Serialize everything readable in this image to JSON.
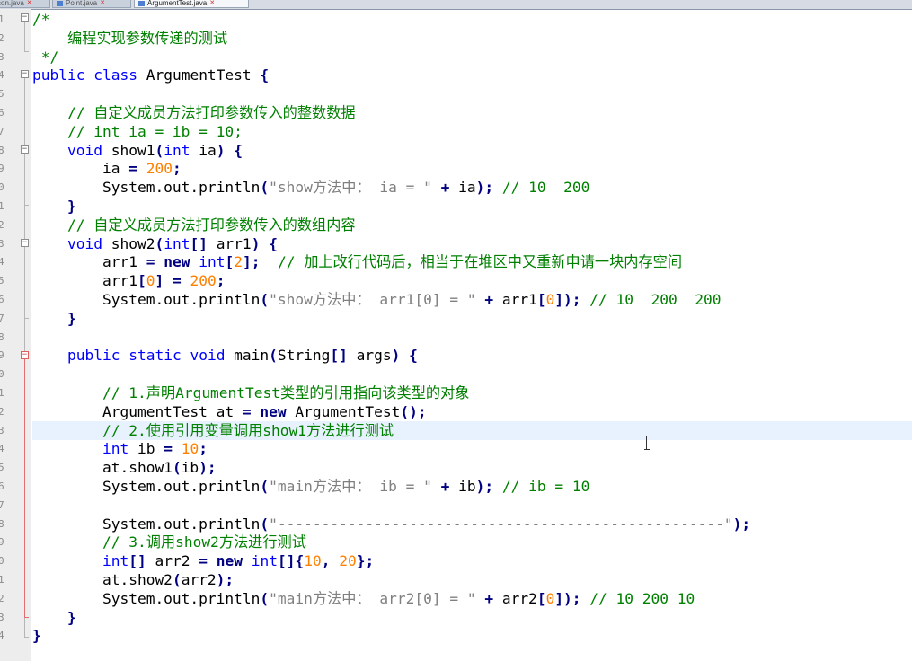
{
  "tabs": [
    {
      "label": "son.java"
    },
    {
      "label": "Point.java"
    },
    {
      "label": "ArgumentTest.java"
    }
  ],
  "line_numbers": [
    "1",
    "2",
    "3",
    "4",
    "5",
    "6",
    "7",
    "8",
    "9",
    "0",
    "1",
    "2",
    "3",
    "4",
    "5",
    "6",
    "7",
    "8",
    "9",
    "0",
    "1",
    "2",
    "3",
    "4",
    "5",
    "6",
    "7",
    "8",
    "9",
    "0",
    "1",
    "2",
    "3",
    "4"
  ],
  "lines": [
    [
      {
        "t": "/*",
        "c": "cm"
      }
    ],
    [
      {
        "t": "    ",
        "c": ""
      },
      {
        "t": "编程实现参数传递的测试",
        "c": "cm cn"
      }
    ],
    [
      {
        "t": " */",
        "c": "cm"
      }
    ],
    [
      {
        "t": "public",
        "c": "kw"
      },
      {
        "t": " ",
        "c": ""
      },
      {
        "t": "class",
        "c": "kw"
      },
      {
        "t": " ArgumentTest ",
        "c": ""
      },
      {
        "t": "{",
        "c": "op"
      }
    ],
    [],
    [
      {
        "t": "    // ",
        "c": "cm"
      },
      {
        "t": "自定义成员方法打印参数传入的整数数据",
        "c": "cm cn"
      }
    ],
    [
      {
        "t": "    // int ia = ib = 10;",
        "c": "cm"
      }
    ],
    [
      {
        "t": "    ",
        "c": ""
      },
      {
        "t": "void",
        "c": "kw"
      },
      {
        "t": " show1",
        "c": ""
      },
      {
        "t": "(",
        "c": "op"
      },
      {
        "t": "int",
        "c": "kw"
      },
      {
        "t": " ia",
        "c": ""
      },
      {
        "t": ")",
        "c": "op"
      },
      {
        "t": " ",
        "c": ""
      },
      {
        "t": "{",
        "c": "op"
      }
    ],
    [
      {
        "t": "        ia ",
        "c": ""
      },
      {
        "t": "=",
        "c": "op"
      },
      {
        "t": " ",
        "c": ""
      },
      {
        "t": "200",
        "c": "num"
      },
      {
        "t": ";",
        "c": "op"
      }
    ],
    [
      {
        "t": "        System.out.println",
        "c": ""
      },
      {
        "t": "(",
        "c": "op"
      },
      {
        "t": "\"show",
        "c": "str"
      },
      {
        "t": "方法中：",
        "c": "str cn"
      },
      {
        "t": " ia = \"",
        "c": "str"
      },
      {
        "t": " ",
        "c": ""
      },
      {
        "t": "+",
        "c": "op"
      },
      {
        "t": " ia",
        "c": ""
      },
      {
        "t": ");",
        "c": "op"
      },
      {
        "t": " // 10  200",
        "c": "cm"
      }
    ],
    [
      {
        "t": "    ",
        "c": ""
      },
      {
        "t": "}",
        "c": "op"
      }
    ],
    [
      {
        "t": "    // ",
        "c": "cm"
      },
      {
        "t": "自定义成员方法打印参数传入的数组内容",
        "c": "cm cn"
      }
    ],
    [
      {
        "t": "    ",
        "c": ""
      },
      {
        "t": "void",
        "c": "kw"
      },
      {
        "t": " show2",
        "c": ""
      },
      {
        "t": "(",
        "c": "op"
      },
      {
        "t": "int",
        "c": "kw"
      },
      {
        "t": "[]",
        "c": "op"
      },
      {
        "t": " arr1",
        "c": ""
      },
      {
        "t": ")",
        "c": "op"
      },
      {
        "t": " ",
        "c": ""
      },
      {
        "t": "{",
        "c": "op"
      }
    ],
    [
      {
        "t": "        arr1 ",
        "c": ""
      },
      {
        "t": "=",
        "c": "op"
      },
      {
        "t": " ",
        "c": ""
      },
      {
        "t": "new",
        "c": "kw op"
      },
      {
        "t": " ",
        "c": ""
      },
      {
        "t": "int",
        "c": "kw"
      },
      {
        "t": "[",
        "c": "op"
      },
      {
        "t": "2",
        "c": "num"
      },
      {
        "t": "];",
        "c": "op"
      },
      {
        "t": "  // ",
        "c": "cm"
      },
      {
        "t": "加上改行代码后，相当于在堆区中又重新申请一块内存空间",
        "c": "cm cn"
      }
    ],
    [
      {
        "t": "        arr1",
        "c": ""
      },
      {
        "t": "[",
        "c": "op"
      },
      {
        "t": "0",
        "c": "num"
      },
      {
        "t": "]",
        "c": "op"
      },
      {
        "t": " ",
        "c": ""
      },
      {
        "t": "=",
        "c": "op"
      },
      {
        "t": " ",
        "c": ""
      },
      {
        "t": "200",
        "c": "num"
      },
      {
        "t": ";",
        "c": "op"
      }
    ],
    [
      {
        "t": "        System.out.println",
        "c": ""
      },
      {
        "t": "(",
        "c": "op"
      },
      {
        "t": "\"show",
        "c": "str"
      },
      {
        "t": "方法中：",
        "c": "str cn"
      },
      {
        "t": " arr1[0] = \"",
        "c": "str"
      },
      {
        "t": " ",
        "c": ""
      },
      {
        "t": "+",
        "c": "op"
      },
      {
        "t": " arr1",
        "c": ""
      },
      {
        "t": "[",
        "c": "op"
      },
      {
        "t": "0",
        "c": "num"
      },
      {
        "t": "]);",
        "c": "op"
      },
      {
        "t": " // 10  200  200",
        "c": "cm"
      }
    ],
    [
      {
        "t": "    ",
        "c": ""
      },
      {
        "t": "}",
        "c": "op"
      }
    ],
    [],
    [
      {
        "t": "    ",
        "c": ""
      },
      {
        "t": "public",
        "c": "kw"
      },
      {
        "t": " ",
        "c": ""
      },
      {
        "t": "static",
        "c": "kw"
      },
      {
        "t": " ",
        "c": ""
      },
      {
        "t": "void",
        "c": "kw"
      },
      {
        "t": " main",
        "c": ""
      },
      {
        "t": "(",
        "c": "op"
      },
      {
        "t": "String",
        "c": ""
      },
      {
        "t": "[]",
        "c": "op"
      },
      {
        "t": " args",
        "c": ""
      },
      {
        "t": ")",
        "c": "op"
      },
      {
        "t": " ",
        "c": ""
      },
      {
        "t": "{",
        "c": "op"
      }
    ],
    [],
    [
      {
        "t": "        // 1.",
        "c": "cm"
      },
      {
        "t": "声明",
        "c": "cm cn"
      },
      {
        "t": "ArgumentTest",
        "c": "cm"
      },
      {
        "t": "类型的引用指向该类型的对象",
        "c": "cm cn"
      }
    ],
    [
      {
        "t": "        ArgumentTest at ",
        "c": ""
      },
      {
        "t": "=",
        "c": "op"
      },
      {
        "t": " ",
        "c": ""
      },
      {
        "t": "new",
        "c": "kw op"
      },
      {
        "t": " ArgumentTest",
        "c": ""
      },
      {
        "t": "();",
        "c": "op"
      }
    ],
    [
      {
        "t": "        // 2.",
        "c": "cm"
      },
      {
        "t": "使用引用变量调用",
        "c": "cm cn"
      },
      {
        "t": "show1",
        "c": "cm"
      },
      {
        "t": "方法进行测试",
        "c": "cm cn"
      }
    ],
    [
      {
        "t": "        ",
        "c": ""
      },
      {
        "t": "int",
        "c": "kw"
      },
      {
        "t": " ib ",
        "c": ""
      },
      {
        "t": "=",
        "c": "op"
      },
      {
        "t": " ",
        "c": ""
      },
      {
        "t": "10",
        "c": "num"
      },
      {
        "t": ";",
        "c": "op"
      }
    ],
    [
      {
        "t": "        at.show1",
        "c": ""
      },
      {
        "t": "(",
        "c": "op"
      },
      {
        "t": "ib",
        "c": ""
      },
      {
        "t": ");",
        "c": "op"
      }
    ],
    [
      {
        "t": "        System.out.println",
        "c": ""
      },
      {
        "t": "(",
        "c": "op"
      },
      {
        "t": "\"main",
        "c": "str"
      },
      {
        "t": "方法中：",
        "c": "str cn"
      },
      {
        "t": " ib = \"",
        "c": "str"
      },
      {
        "t": " ",
        "c": ""
      },
      {
        "t": "+",
        "c": "op"
      },
      {
        "t": " ib",
        "c": ""
      },
      {
        "t": ");",
        "c": "op"
      },
      {
        "t": " // ib = 10",
        "c": "cm"
      }
    ],
    [],
    [
      {
        "t": "        System.out.println",
        "c": ""
      },
      {
        "t": "(",
        "c": "op"
      },
      {
        "t": "\"---------------------------------------------------\"",
        "c": "str"
      },
      {
        "t": ");",
        "c": "op"
      }
    ],
    [
      {
        "t": "        // 3.",
        "c": "cm"
      },
      {
        "t": "调用",
        "c": "cm cn"
      },
      {
        "t": "show2",
        "c": "cm"
      },
      {
        "t": "方法进行测试",
        "c": "cm cn"
      }
    ],
    [
      {
        "t": "        ",
        "c": ""
      },
      {
        "t": "int",
        "c": "kw"
      },
      {
        "t": "[]",
        "c": "op"
      },
      {
        "t": " arr2 ",
        "c": ""
      },
      {
        "t": "=",
        "c": "op"
      },
      {
        "t": " ",
        "c": ""
      },
      {
        "t": "new",
        "c": "kw op"
      },
      {
        "t": " ",
        "c": ""
      },
      {
        "t": "int",
        "c": "kw"
      },
      {
        "t": "[]{",
        "c": "op"
      },
      {
        "t": "10",
        "c": "num"
      },
      {
        "t": ", ",
        "c": "op"
      },
      {
        "t": "20",
        "c": "num"
      },
      {
        "t": "};",
        "c": "op"
      }
    ],
    [
      {
        "t": "        at.show2",
        "c": ""
      },
      {
        "t": "(",
        "c": "op"
      },
      {
        "t": "arr2",
        "c": ""
      },
      {
        "t": ");",
        "c": "op"
      }
    ],
    [
      {
        "t": "        System.out.println",
        "c": ""
      },
      {
        "t": "(",
        "c": "op"
      },
      {
        "t": "\"main",
        "c": "str"
      },
      {
        "t": "方法中：",
        "c": "str cn"
      },
      {
        "t": " arr2[0] = \"",
        "c": "str"
      },
      {
        "t": " ",
        "c": ""
      },
      {
        "t": "+",
        "c": "op"
      },
      {
        "t": " arr2",
        "c": ""
      },
      {
        "t": "[",
        "c": "op"
      },
      {
        "t": "0",
        "c": "num"
      },
      {
        "t": "]);",
        "c": "op"
      },
      {
        "t": " // 10 200 10",
        "c": "cm"
      }
    ],
    [
      {
        "t": "    ",
        "c": ""
      },
      {
        "t": "}",
        "c": "op"
      }
    ],
    [
      {
        "t": "}",
        "c": "op"
      }
    ]
  ],
  "current_line": 23
}
